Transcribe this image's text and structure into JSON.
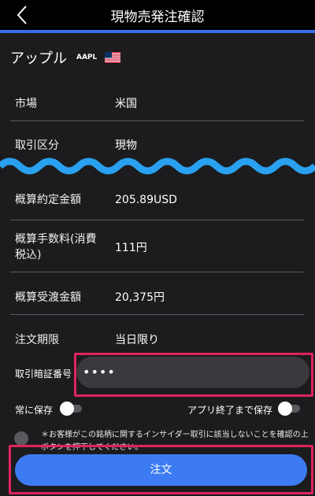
{
  "header": {
    "title": "現物売発注確認"
  },
  "stock": {
    "name": "アップル",
    "ticker": "AAPL"
  },
  "rows": [
    {
      "label": "市場",
      "value": "米国"
    },
    {
      "label": "取引区分",
      "value": "現物"
    },
    {
      "label": "概算約定金額",
      "value": "205.89USD"
    },
    {
      "label": "概算手数料(消費\n税込)",
      "value": "111円"
    },
    {
      "label": "概算受渡金額",
      "value": "20,375円"
    },
    {
      "label": "注文期限",
      "value": "当日限り"
    }
  ],
  "pin": {
    "label": "取引暗証番号",
    "value": "••••"
  },
  "toggles": {
    "always_save": {
      "label": "常に保存",
      "on": false
    },
    "save_until_exit": {
      "label": "アプリ終了まで保存",
      "on": false
    }
  },
  "notice": {
    "text": "＊お客様がこの銘柄に関するインサイダー取引に該当しないことを確認の上ボタンを押下してください。"
  },
  "order_button": {
    "label": "注文"
  },
  "colors": {
    "accent": "#3c6be6",
    "button": "#3d7bf2",
    "highlight": "#e0245e"
  }
}
